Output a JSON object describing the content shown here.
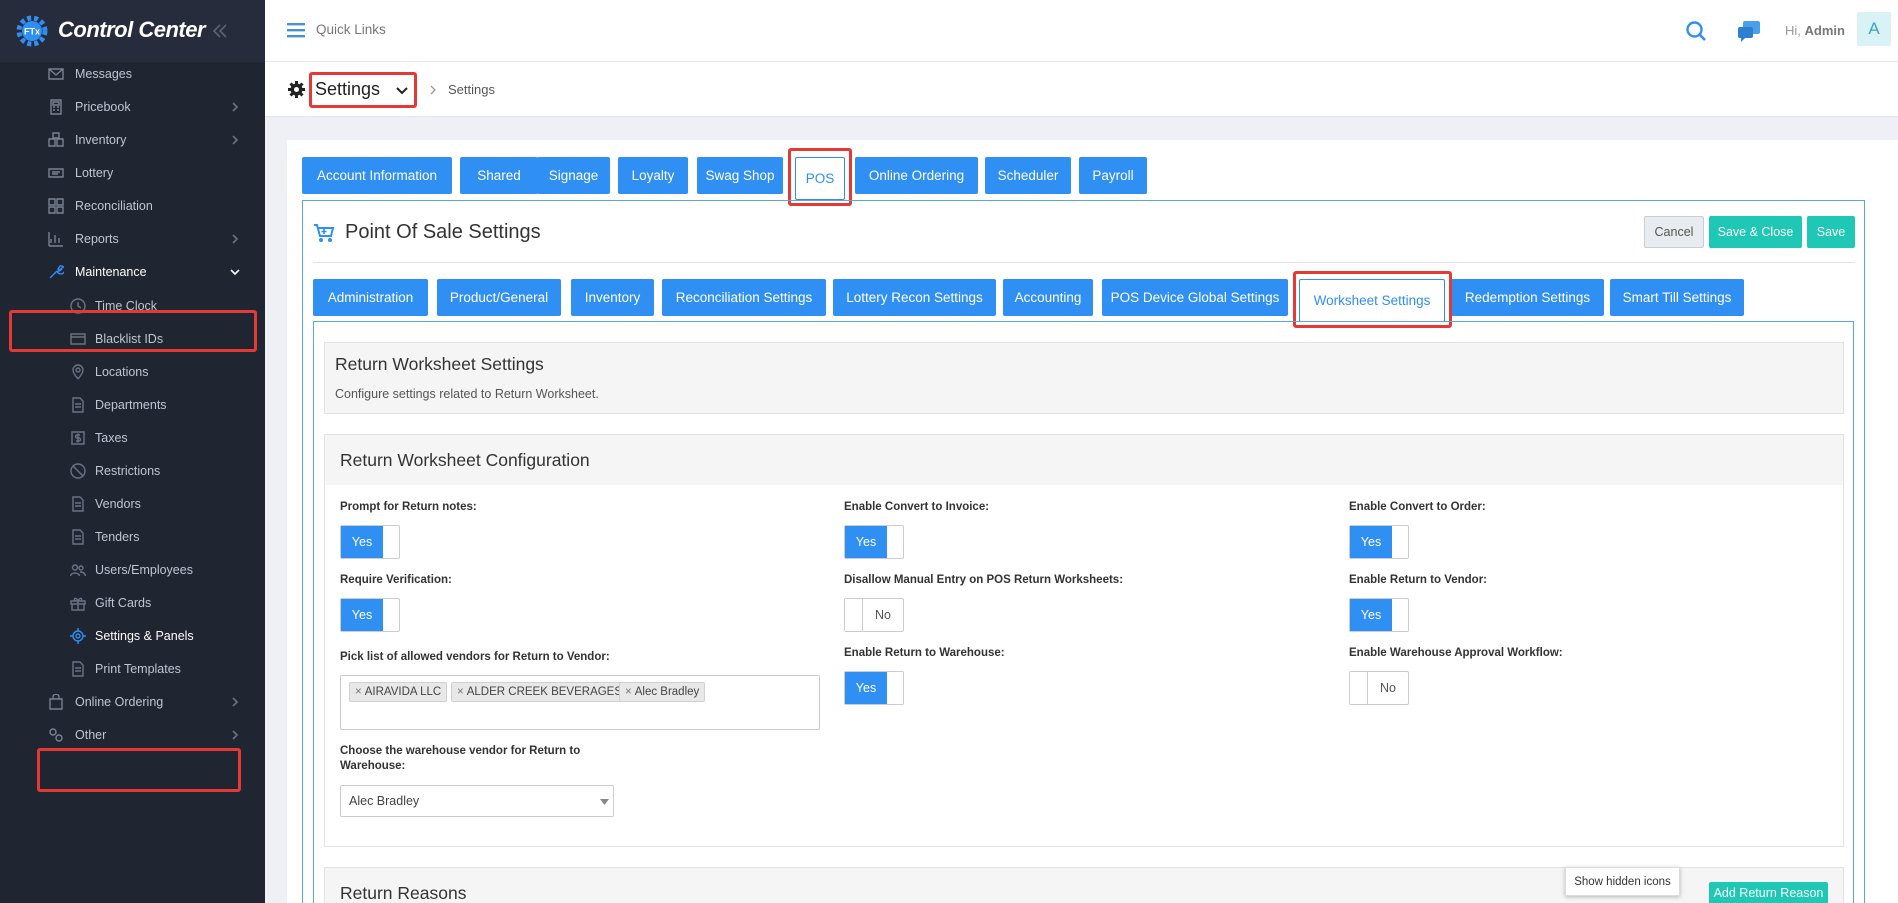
{
  "app": {
    "title": "Control Center",
    "logo_badge": "FTx"
  },
  "colors": {
    "sidebar_bg": "#1f2531",
    "accent": "#2f8ff2",
    "teal": "#1ec8b4",
    "highlight": "#e53935"
  },
  "sidebar": {
    "items": [
      {
        "label": "Messages",
        "icon": "envelope-icon"
      },
      {
        "label": "Pricebook",
        "icon": "calculator-icon"
      },
      {
        "label": "Inventory",
        "icon": "boxes-icon"
      },
      {
        "label": "Lottery",
        "icon": "ticket-icon"
      },
      {
        "label": "Reconciliation",
        "icon": "grid-icon"
      },
      {
        "label": "Reports",
        "icon": "chart-icon"
      },
      {
        "label": "Maintenance",
        "icon": "wrench-icon"
      },
      {
        "label": "Online Ordering",
        "icon": "bag-icon"
      },
      {
        "label": "Other",
        "icon": "cogs-icon"
      }
    ],
    "sub_items": [
      {
        "label": "Time Clock",
        "icon": "clock-icon"
      },
      {
        "label": "Blacklist IDs",
        "icon": "card-icon"
      },
      {
        "label": "Locations",
        "icon": "pin-icon"
      },
      {
        "label": "Departments",
        "icon": "doc-icon"
      },
      {
        "label": "Taxes",
        "icon": "dollar-icon"
      },
      {
        "label": "Restrictions",
        "icon": "ban-icon"
      },
      {
        "label": "Vendors",
        "icon": "doc-icon"
      },
      {
        "label": "Tenders",
        "icon": "doc-icon"
      },
      {
        "label": "Users/Employees",
        "icon": "users-icon"
      },
      {
        "label": "Gift Cards",
        "icon": "gift-icon"
      },
      {
        "label": "Settings & Panels",
        "icon": "gear-icon"
      },
      {
        "label": "Print Templates",
        "icon": "doc-icon"
      }
    ]
  },
  "header": {
    "quick_links": "Quick Links",
    "greeting": "Hi,",
    "user": "Admin",
    "avatar_letter": "A"
  },
  "breadcrumb": {
    "dropdown": "Settings",
    "current": "Settings"
  },
  "top_tabs": [
    "Account Information",
    "Shared",
    "Signage",
    "Loyalty",
    "Swag Shop",
    "POS",
    "Online Ordering",
    "Scheduler",
    "Payroll"
  ],
  "pos": {
    "title": "Point Of Sale Settings",
    "cancel": "Cancel",
    "save_close": "Save & Close",
    "save": "Save"
  },
  "sub_tabs": [
    "Administration",
    "Product/General",
    "Inventory",
    "Reconciliation Settings",
    "Lottery Recon Settings",
    "Accounting",
    "POS Device Global Settings",
    "Worksheet Settings",
    "Redemption Settings",
    "Smart Till Settings"
  ],
  "return_ws": {
    "title": "Return Worksheet Settings",
    "desc": "Configure settings related to Return Worksheet.",
    "config_title": "Return Worksheet Configuration",
    "fields": {
      "prompt_notes": {
        "label": "Prompt for Return notes:",
        "value": "Yes"
      },
      "require_verification": {
        "label": "Require Verification:",
        "value": "Yes"
      },
      "pick_list": {
        "label": "Pick list of allowed vendors for Return to Vendor:"
      },
      "warehouse_vendor": {
        "label": "Choose the warehouse vendor for Return to Warehouse:",
        "value": "Alec Bradley"
      },
      "convert_invoice": {
        "label": "Enable Convert to Invoice:",
        "value": "Yes"
      },
      "disallow_manual": {
        "label": "Disallow Manual Entry on POS Return Worksheets:",
        "value": "No"
      },
      "return_warehouse": {
        "label": "Enable Return to Warehouse:",
        "value": "Yes"
      },
      "convert_order": {
        "label": "Enable Convert to Order:",
        "value": "Yes"
      },
      "return_vendor": {
        "label": "Enable Return to Vendor:",
        "value": "Yes"
      },
      "warehouse_approval": {
        "label": "Enable Warehouse Approval Workflow:",
        "value": "No"
      }
    },
    "vendors": [
      "AIRAVIDA LLC",
      "ALDER CREEK BEVERAGES",
      "Alec Bradley"
    ]
  },
  "return_reasons": {
    "title": "Return Reasons",
    "add_button": "Add Return Reason"
  },
  "tooltip": "Show hidden icons"
}
